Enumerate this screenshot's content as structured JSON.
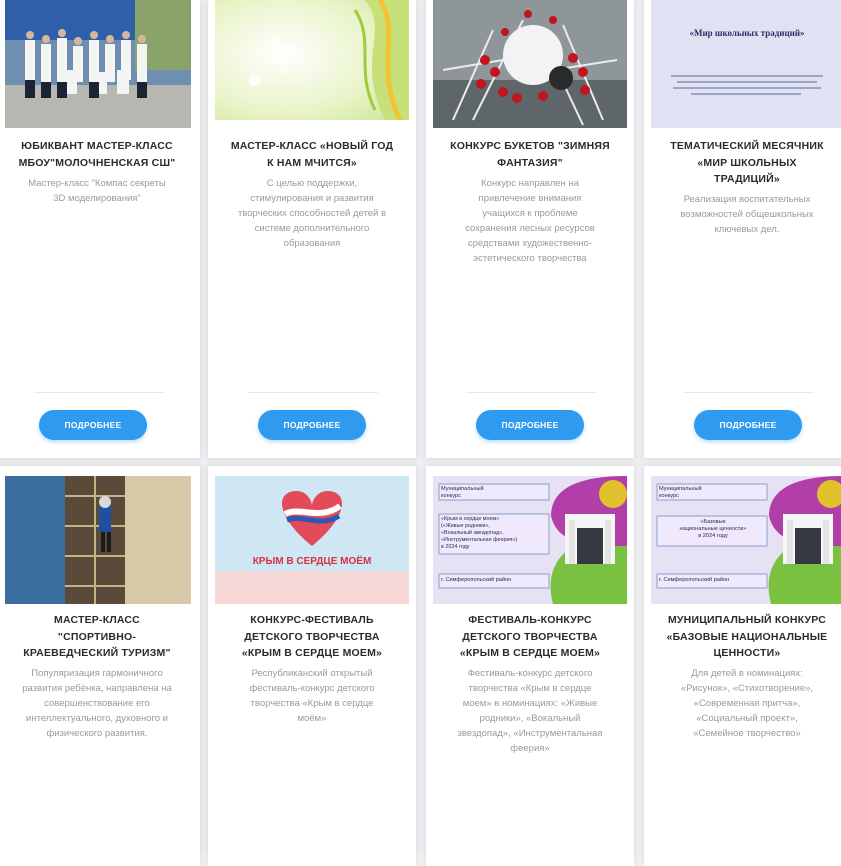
{
  "cards_row1": [
    {
      "title": "ЮБИКВАНТ МАСТЕР-КЛАСС\nМБОУ\"МОЛОЧНЕНСКАЯ СШ\"",
      "desc": "Мастер-класс \"Компас секреты\n3D моделирования\"",
      "button": "ПОДРОБНЕЕ"
    },
    {
      "title": "МАСТЕР-КЛАСС «НОВЫЙ ГОД\nК НАМ МЧИТСЯ»",
      "desc": "С целью поддержки,\nстимулирования и развития\nтворческих способностей детей в\nсистеме дополнительного\nобразования",
      "button": "ПОДРОБНЕЕ"
    },
    {
      "title": "КОНКУРС БУКЕТОВ \"ЗИМНЯЯ\nФАНТАЗИЯ\"",
      "desc": "Конкурс направлен на\nпривлечение внимания\nучащихся к проблеме\nсохранения лесных ресурсов\nсредствами художественно-\nэстетического творчества",
      "button": "ПОДРОБНЕЕ"
    },
    {
      "title": "ТЕМАТИЧЕСКИЙ МЕСЯЧНИК\n«МИР ШКОЛЬНЫХ\nТРАДИЦИЙ»",
      "desc": "Реализация воспитательных\nвозможностей общешкольных\nключевых дел.",
      "button": "ПОДРОБНЕЕ",
      "thumb_text": "«Мир школьных традиций»"
    }
  ],
  "cards_row2": [
    {
      "title": "МАСТЕР-КЛАСС\n\"СПОРТИВНО-\nКРАЕВЕДЧЕСКИЙ ТУРИЗМ\"",
      "desc": "Популяризация гармоничного\nразвития ребёнка, направлена на\nсовершенствование его\nинтеллектуального, духовного и\nфизического развития."
    },
    {
      "title": "КОНКУРС-ФЕСТИВАЛЬ\nДЕТСКОГО ТВОРЧЕСТВА\n«КРЫМ В СЕРДЦЕ МОЕМ»",
      "desc": "Республиканский открытый\nфестиваль-конкурс детского\nтворчества «Крым в сердце\nмоём»",
      "thumb_text": "КРЫМ В СЕРДЦЕ МОЁМ"
    },
    {
      "title": "ФЕСТИВАЛЬ-КОНКУРС\nДЕТСКОГО ТВОРЧЕСТВА\n«КРЫМ В СЕРДЦЕ МОЕМ»",
      "desc": "Фестиваль-конкурс детского\nтворчества «Крым в сердце\nмоем» в номинациях: «Живые\nродники», «Вокальный\nзвездопад», «Инструментальная\nфеерия»",
      "thumb_lines": [
        "Муниципальный",
        "конкурс",
        "«Крым в сердце моем»",
        "(«Живые родники»,",
        "«Вокальный звездопад»,",
        "«Инструментальная феерия»)",
        "в 2024 году",
        "г. Симферопольский район"
      ]
    },
    {
      "title": "МУНИЦИПАЛЬНЫЙ КОНКУРС\n«БАЗОВЫЕ НАЦИОНАЛЬНЫЕ\nЦЕННОСТИ»",
      "desc": "Для детей в номинациях:\n«Рисунок», «Стихотворение»,\n«Современная притча»,\n«Социальный проект»,\n«Семейное творчество»",
      "thumb_lines": [
        "Муниципальный",
        "конкурс",
        "«Базовые",
        "национальные ценности»",
        "в 2024 году",
        "г. Симферопольский район"
      ]
    }
  ],
  "colors": {
    "button": "#2f9bf0",
    "title": "#2b2b2b",
    "desc": "#9a9a9a"
  }
}
